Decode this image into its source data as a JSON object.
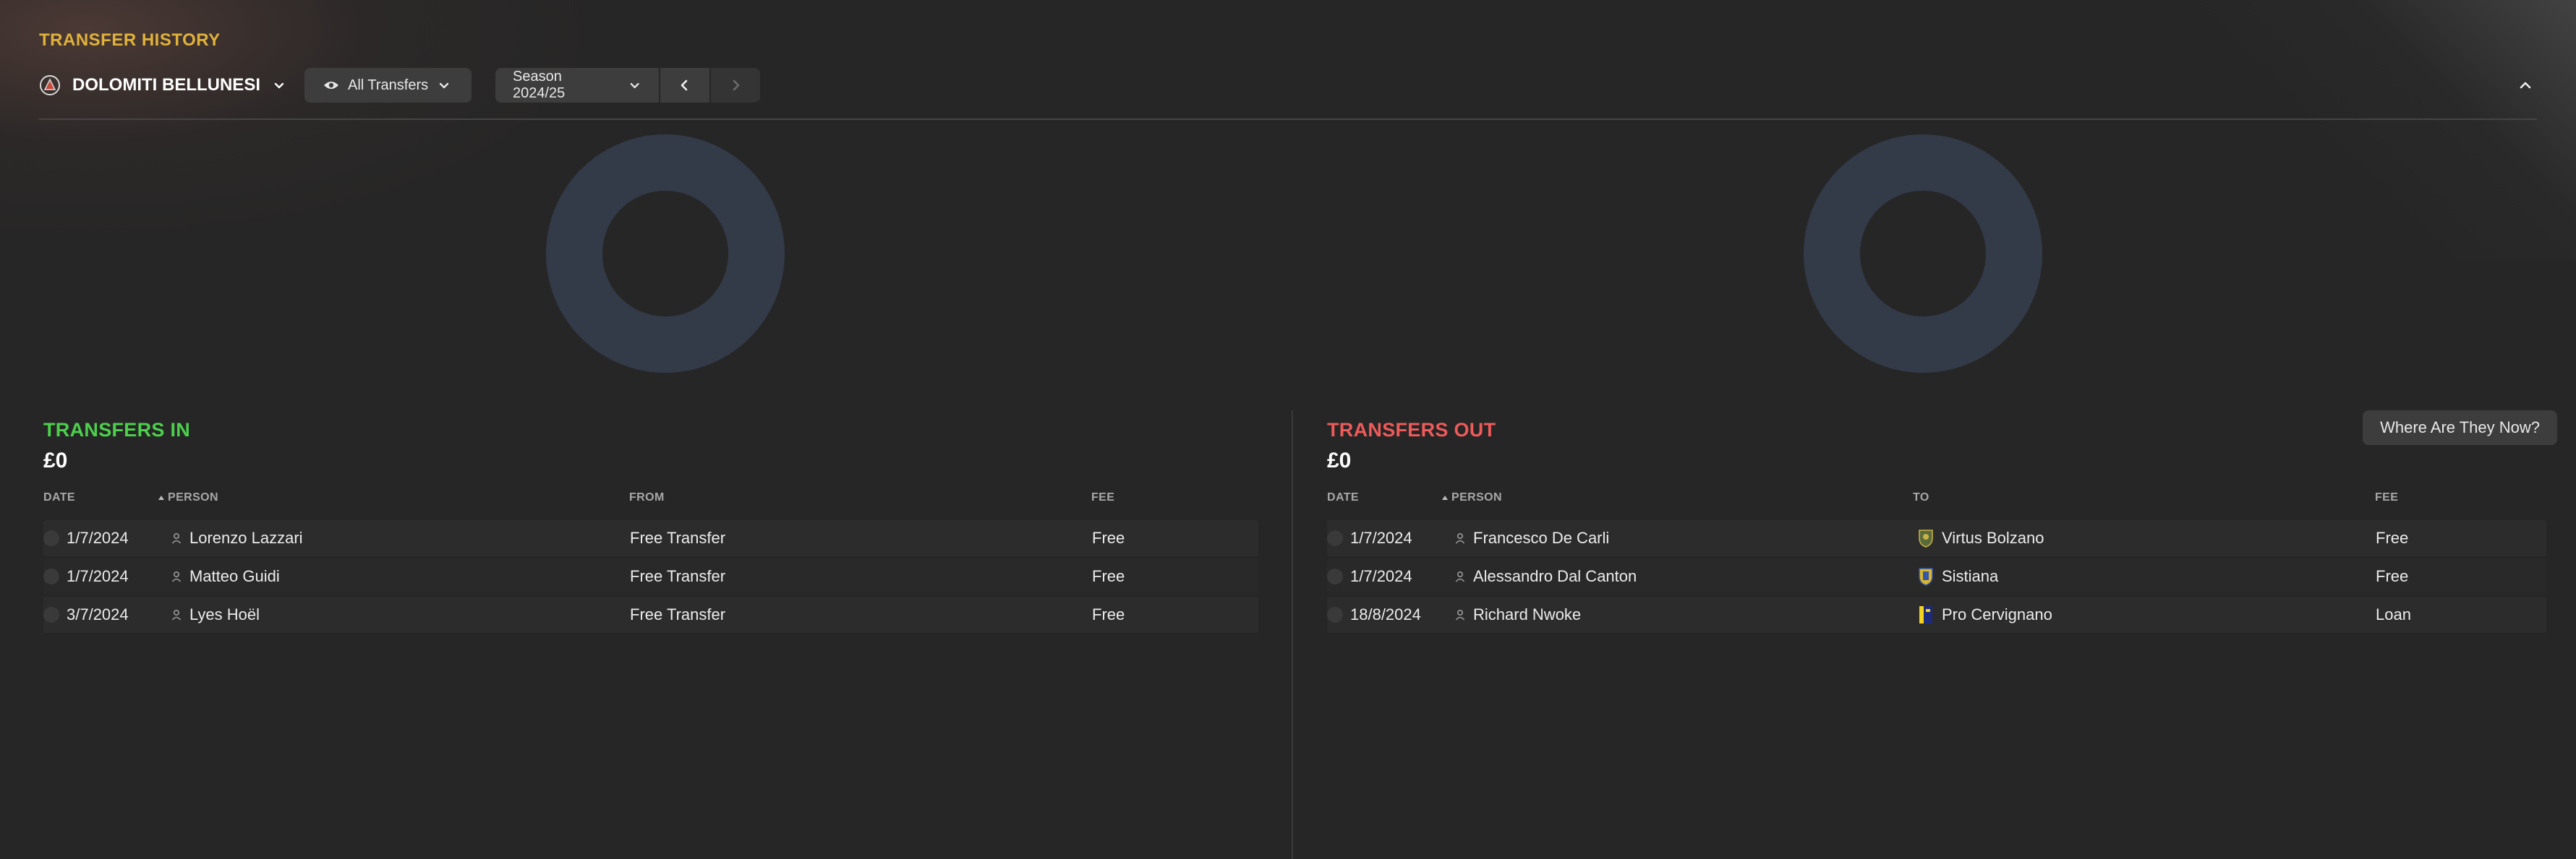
{
  "page": {
    "title": "TRANSFER HISTORY"
  },
  "toolbar": {
    "club_name": "DOLOMITI BELLUNESI",
    "filter_label": "All Transfers",
    "season_label": "Season 2024/25"
  },
  "transfers_in": {
    "title": "TRANSFERS IN",
    "total": "£0",
    "columns": {
      "date": "DATE",
      "person": "PERSON",
      "from": "FROM",
      "fee": "FEE"
    },
    "rows": [
      {
        "date": "1/7/2024",
        "person": "Lorenzo Lazzari",
        "from": "Free Transfer",
        "fee": "Free"
      },
      {
        "date": "1/7/2024",
        "person": "Matteo Guidi",
        "from": "Free Transfer",
        "fee": "Free"
      },
      {
        "date": "3/7/2024",
        "person": "Lyes Hoël",
        "from": "Free Transfer",
        "fee": "Free"
      }
    ]
  },
  "transfers_out": {
    "title": "TRANSFERS OUT",
    "total": "£0",
    "where_button": "Where Are They Now?",
    "columns": {
      "date": "DATE",
      "person": "PERSON",
      "to": "TO",
      "fee": "FEE"
    },
    "rows": [
      {
        "date": "1/7/2024",
        "person": "Francesco De Carli",
        "to": "Virtus Bolzano",
        "fee": "Free"
      },
      {
        "date": "1/7/2024",
        "person": "Alessandro Dal Canton",
        "to": "Sistiana",
        "fee": "Free"
      },
      {
        "date": "18/8/2024",
        "person": "Richard Nwoke",
        "to": "Pro Cervignano",
        "fee": "Loan"
      }
    ]
  },
  "colors": {
    "accent_title": "#e0b23c",
    "transfers_in": "#4cd04c",
    "transfers_out": "#ef5a5a",
    "donut": "#333a48"
  },
  "icons": [
    "club-crest-icon",
    "chevron-down-icon",
    "eye-icon",
    "chevron-left-icon",
    "chevron-right-icon",
    "chevron-up-icon",
    "sort-up-icon",
    "person-icon",
    "status-dot-icon",
    "club-badge-icon"
  ]
}
